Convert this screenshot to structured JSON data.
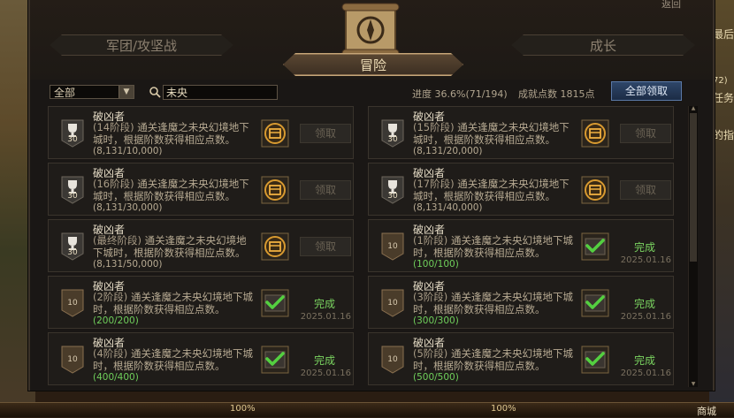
{
  "window": {
    "tabs": {
      "left": "军团/攻坚战",
      "right": "成长",
      "active": "冒险"
    },
    "corner_link": "返回"
  },
  "filter": {
    "category_selected": "全部",
    "search_value": "未央",
    "progress": "进度 36.6%(71/194)",
    "points": "成就点数 1815点",
    "claim_all_label": "全部领取"
  },
  "achievements": [
    {
      "title": "破凶者",
      "stage": "(14阶段)",
      "desc": "通关逢魔之未央幻境地下城时，根据阶数获得相应点数。",
      "count": "(8,131/10,000)",
      "badge": "30",
      "badge_type": "trophy",
      "status": "pending",
      "btn": "领取"
    },
    {
      "title": "破凶者",
      "stage": "(15阶段)",
      "desc": "通关逢魔之未央幻境地下城时，根据阶数获得相应点数。",
      "count": "(8,131/20,000)",
      "badge": "30",
      "badge_type": "trophy",
      "status": "pending",
      "btn": "领取"
    },
    {
      "title": "破凶者",
      "stage": "(16阶段)",
      "desc": "通关逢魔之未央幻境地下城时，根据阶数获得相应点数。",
      "count": "(8,131/30,000)",
      "badge": "30",
      "badge_type": "trophy",
      "status": "pending",
      "btn": "领取"
    },
    {
      "title": "破凶者",
      "stage": "(17阶段)",
      "desc": "通关逢魔之未央幻境地下城时，根据阶数获得相应点数。",
      "count": "(8,131/40,000)",
      "badge": "30",
      "badge_type": "trophy",
      "status": "pending",
      "btn": "领取"
    },
    {
      "title": "破凶者",
      "stage": "(最终阶段)",
      "desc": "通关逢魔之未央幻境地下城时，根据阶数获得相应点数。",
      "count": "(8,131/50,000)",
      "badge": "30",
      "badge_type": "trophy",
      "status": "pending",
      "btn": "领取"
    },
    {
      "title": "破凶者",
      "stage": "(1阶段)",
      "desc": "通关逢魔之未央幻境地下城时，根据阶数获得相应点数。",
      "count": "(100/100)",
      "badge": "10",
      "badge_type": "bronze",
      "status": "done",
      "done": "完成",
      "date": "2025.01.16"
    },
    {
      "title": "破凶者",
      "stage": "(2阶段)",
      "desc": "通关逢魔之未央幻境地下城时，根据阶数获得相应点数。",
      "count": "(200/200)",
      "badge": "10",
      "badge_type": "bronze",
      "status": "done",
      "done": "完成",
      "date": "2025.01.16"
    },
    {
      "title": "破凶者",
      "stage": "(3阶段)",
      "desc": "通关逢魔之未央幻境地下城时，根据阶数获得相应点数。",
      "count": "(300/300)",
      "badge": "10",
      "badge_type": "bronze",
      "status": "done",
      "done": "完成",
      "date": "2025.01.16"
    },
    {
      "title": "破凶者",
      "stage": "(4阶段)",
      "desc": "通关逢魔之未央幻境地下城时，根据阶数获得相应点数。",
      "count": "(400/400)",
      "badge": "10",
      "badge_type": "bronze",
      "status": "done",
      "done": "完成",
      "date": "2025.01.16"
    },
    {
      "title": "破凶者",
      "stage": "(5阶段)",
      "desc": "通关逢魔之未央幻境地下城时，根据阶数获得相应点数。",
      "count": "(500/500)",
      "badge": "10",
      "badge_type": "bronze",
      "status": "done",
      "done": "完成",
      "date": "2025.01.16"
    }
  ],
  "side_right": {
    "line1": "最后",
    "line2": "72)",
    "line3": "任务",
    "line4": "的指"
  },
  "bottom_bar": {
    "hp": "100%",
    "mp": "100%",
    "town": "商城"
  },
  "colors": {
    "accent_gold": "#c6a678",
    "done_green": "#7ad460",
    "claim_all_blue": "#2e4669"
  }
}
